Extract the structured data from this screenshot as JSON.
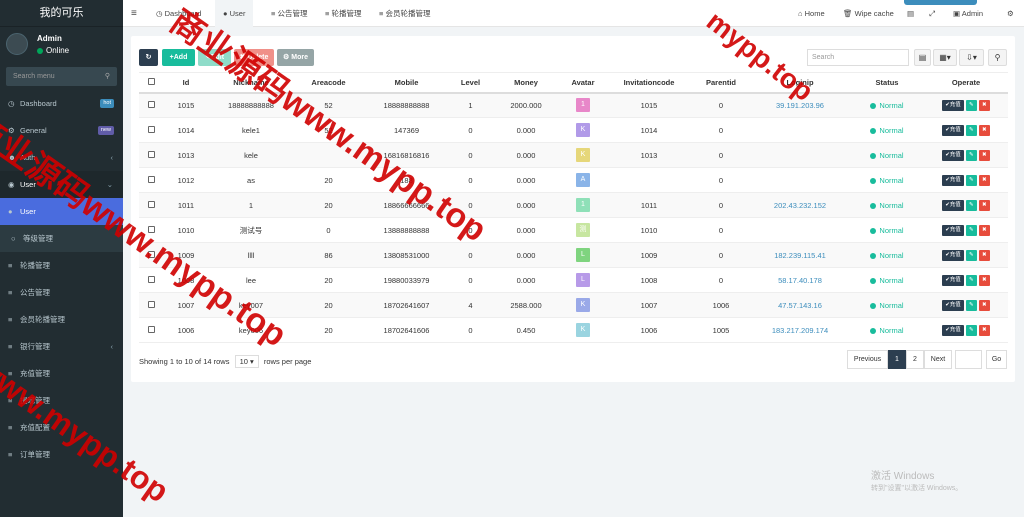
{
  "app": {
    "title": "我的可乐"
  },
  "user": {
    "name": "Admin",
    "status": "Online"
  },
  "sidebar": {
    "search_placeholder": "Search menu",
    "items": [
      {
        "label": "Dashboard",
        "badge": "hot",
        "badge_color": "#3c8dbc"
      },
      {
        "label": "General",
        "badge": "new",
        "badge_color": "#605ca8"
      },
      {
        "label": "Auth"
      },
      {
        "label": "User"
      },
      {
        "label": "User"
      },
      {
        "label": "等级管理"
      },
      {
        "label": "轮播管理"
      },
      {
        "label": "公告管理"
      },
      {
        "label": "会员轮播管理"
      },
      {
        "label": "银行管理"
      },
      {
        "label": "充值管理"
      },
      {
        "label": "提现管理"
      },
      {
        "label": "充值配置"
      },
      {
        "label": "订单管理"
      }
    ]
  },
  "topbar": {
    "tabs": [
      {
        "label": "Dashboard"
      },
      {
        "label": "User"
      },
      {
        "label": "公告管理"
      },
      {
        "label": "轮播管理"
      },
      {
        "label": "会员轮播管理"
      }
    ],
    "home": "Home",
    "wipe": "Wipe cache",
    "admin": "Admin"
  },
  "toolbar": {
    "add": "Add",
    "edit": "Edit",
    "delete": "Delete",
    "more": "More",
    "search_placeholder": "Search"
  },
  "table": {
    "headers": [
      "Id",
      "Nickname",
      "Areacode",
      "Mobile",
      "Level",
      "Money",
      "Avatar",
      "Invitationcode",
      "Parentid",
      "Loginip",
      "Status",
      "Operate"
    ],
    "recharge_label": "充值",
    "status_label": "Normal",
    "rows": [
      {
        "id": "1015",
        "nickname": "18888888888",
        "areacode": "52",
        "mobile": "18888888888",
        "level": "1",
        "money": "2000.000",
        "avatar": "1",
        "avatar_color": "#e887c9",
        "invitationcode": "1015",
        "parentid": "0",
        "loginip": "39.191.203.96"
      },
      {
        "id": "1014",
        "nickname": "kele1",
        "areacode": "52",
        "mobile": "147369",
        "level": "0",
        "money": "0.000",
        "avatar": "K",
        "avatar_color": "#b19ae8",
        "invitationcode": "1014",
        "parentid": "0",
        "loginip": ""
      },
      {
        "id": "1013",
        "nickname": "kele",
        "areacode": "",
        "mobile": "16816816816",
        "level": "0",
        "money": "0.000",
        "avatar": "K",
        "avatar_color": "#e6d77a",
        "invitationcode": "1013",
        "parentid": "0",
        "loginip": ""
      },
      {
        "id": "1012",
        "nickname": "as",
        "areacode": "20",
        "mobile": "188",
        "level": "0",
        "money": "0.000",
        "avatar": "A",
        "avatar_color": "#8ab4e8",
        "invitationcode": "",
        "parentid": "0",
        "loginip": ""
      },
      {
        "id": "1011",
        "nickname": "1",
        "areacode": "20",
        "mobile": "18866666666",
        "level": "0",
        "money": "0.000",
        "avatar": "1",
        "avatar_color": "#8fe0b8",
        "invitationcode": "1011",
        "parentid": "0",
        "loginip": "202.43.232.152"
      },
      {
        "id": "1010",
        "nickname": "测试号",
        "areacode": "0",
        "mobile": "13888888888",
        "level": "0",
        "money": "0.000",
        "avatar": "测",
        "avatar_color": "#c7e6a0",
        "invitationcode": "1010",
        "parentid": "0",
        "loginip": ""
      },
      {
        "id": "1009",
        "nickname": "llll",
        "areacode": "86",
        "mobile": "13808531000",
        "level": "0",
        "money": "0.000",
        "avatar": "L",
        "avatar_color": "#7fd47f",
        "invitationcode": "1009",
        "parentid": "0",
        "loginip": "182.239.115.41"
      },
      {
        "id": "1008",
        "nickname": "lee",
        "areacode": "20",
        "mobile": "19880033979",
        "level": "0",
        "money": "0.000",
        "avatar": "L",
        "avatar_color": "#b79ae8",
        "invitationcode": "1008",
        "parentid": "0",
        "loginip": "58.17.40.178"
      },
      {
        "id": "1007",
        "nickname": "key007",
        "areacode": "20",
        "mobile": "18702641607",
        "level": "4",
        "money": "2588.000",
        "avatar": "K",
        "avatar_color": "#9aa9e8",
        "invitationcode": "1007",
        "parentid": "1006",
        "loginip": "47.57.143.16"
      },
      {
        "id": "1006",
        "nickname": "key006",
        "areacode": "20",
        "mobile": "18702641606",
        "level": "0",
        "money": "0.450",
        "avatar": "K",
        "avatar_color": "#9ad4e0",
        "invitationcode": "1006",
        "parentid": "1005",
        "loginip": "183.217.209.174"
      }
    ]
  },
  "footer": {
    "info": "Showing 1 to 10 of 14 rows",
    "per_page": "10",
    "rows_per_page": "rows per page",
    "prev": "Previous",
    "page1": "1",
    "page2": "2",
    "next": "Next",
    "go": "Go"
  },
  "windows": {
    "line1": "激活 Windows",
    "line2": "转到\"设置\"以激活 Windows。"
  },
  "watermark": {
    "a": "mypp.top",
    "b": "商业源码www.mypp.top",
    "c": "商业源码www.mypp.top",
    "d": "www.mypp.top"
  }
}
